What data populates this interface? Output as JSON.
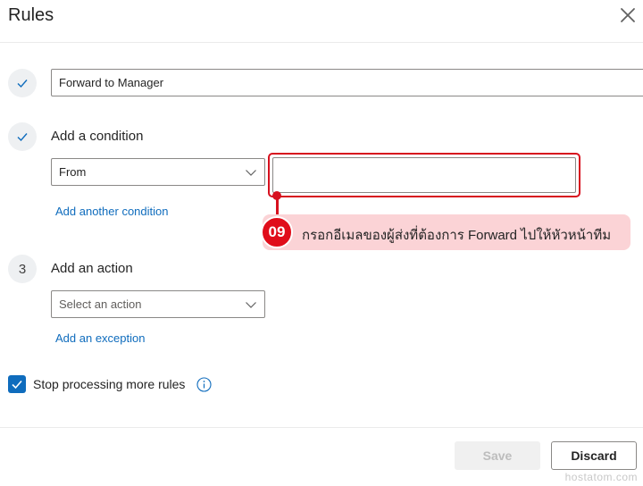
{
  "dialog": {
    "title": "Rules",
    "close_icon": "close-icon"
  },
  "rule_name": {
    "value": "Forward to Manager",
    "check_icon": "checkmark-icon"
  },
  "condition": {
    "heading": "Add a condition",
    "check_icon": "checkmark-icon",
    "select_value": "From",
    "email_value": "",
    "add_another": "Add another condition"
  },
  "annotation": {
    "badge": "09",
    "text": "กรอกอีเมลของผู้ส่งที่ต้องการ Forward ไปให้หัวหน้าทีม",
    "color": "#e00d1a"
  },
  "action": {
    "step_number": "3",
    "heading": "Add an action",
    "placeholder": "Select an action",
    "add_exception": "Add an exception"
  },
  "stop_processing": {
    "label": "Stop processing more rules",
    "checked": true,
    "info_icon": "info-icon"
  },
  "footer": {
    "save_label": "Save",
    "discard_label": "Discard"
  },
  "watermark": "hostatom.com",
  "colors": {
    "accent": "#0f6cbd",
    "highlight": "#d7101e",
    "callout_bg": "#fbd3d6"
  }
}
